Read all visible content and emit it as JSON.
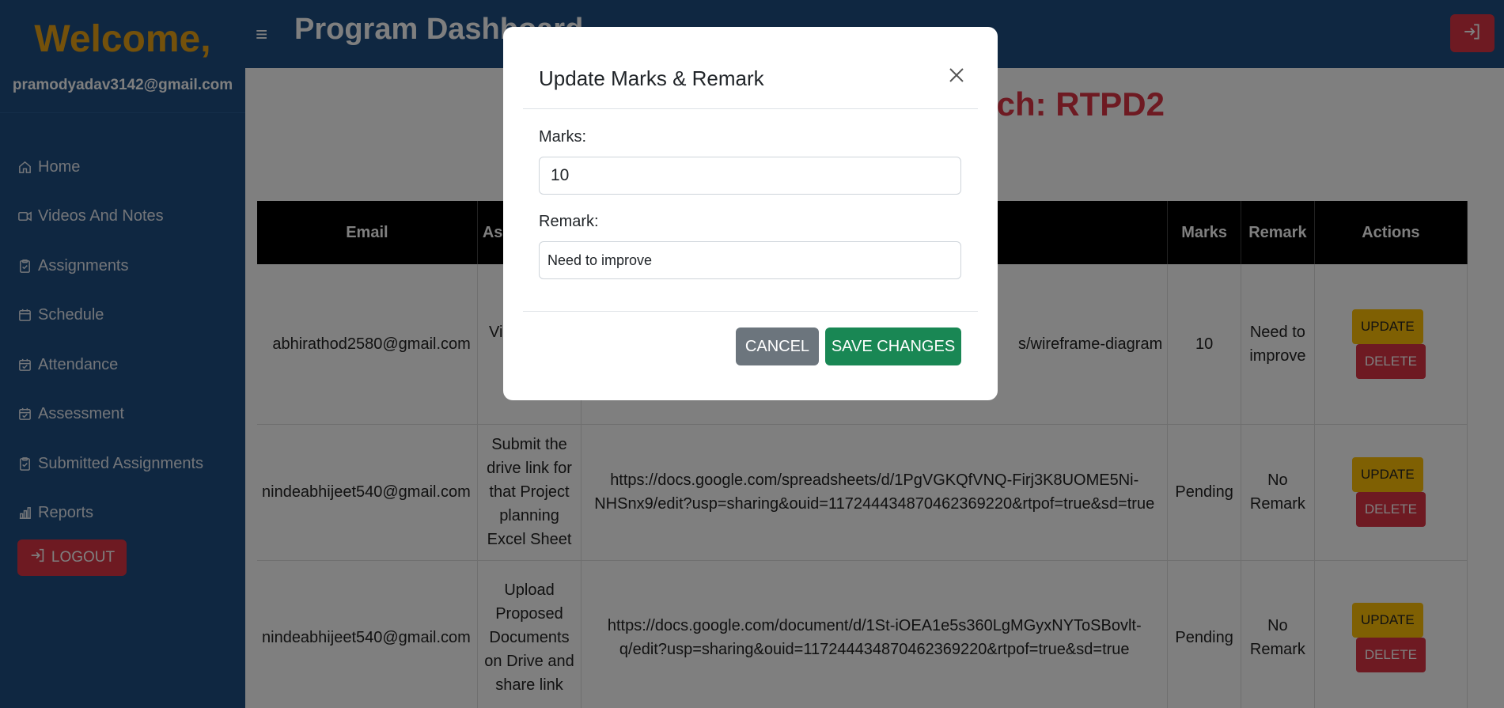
{
  "sidebar": {
    "welcome": "Welcome,",
    "email": "pramodyadav3142@gmail.com",
    "items": [
      {
        "label": "Home",
        "icon": "home-icon"
      },
      {
        "label": "Videos And Notes",
        "icon": "video-icon"
      },
      {
        "label": "Assignments",
        "icon": "clipboard-icon"
      },
      {
        "label": "Schedule",
        "icon": "calendar-icon"
      },
      {
        "label": "Attendance",
        "icon": "calendar-check-icon"
      },
      {
        "label": "Assessment",
        "icon": "calendar-check-icon"
      },
      {
        "label": "Submitted Assignments",
        "icon": "clipboard-icon"
      },
      {
        "label": "Reports",
        "icon": "bar-chart-icon"
      }
    ],
    "logout_label": "LOGOUT"
  },
  "header": {
    "title": "Program Dashboard",
    "menu_icon": "≡"
  },
  "main": {
    "batch_title": "tch: RTPD2",
    "table": {
      "headers": [
        "Email",
        "Ass",
        "",
        "Marks",
        "Remark",
        "Actions"
      ],
      "rows": [
        {
          "email": "abhirathod2580@gmail.com",
          "assignment": "Vie T Vi u n here",
          "link": "s/wireframe-diagram",
          "marks": "10",
          "remark": "Need to improve"
        },
        {
          "email": "nindeabhijeet540@gmail.com",
          "assignment": "Submit the drive link for that Project planning Excel Sheet",
          "link": "https://docs.google.com/spreadsheets/d/1PgVGKQfVNQ-Firj3K8UOME5Ni-NHSnx9/edit?usp=sharing&ouid=117244434870462369220&rtpof=true&sd=true",
          "marks": "Pending",
          "remark": "No Remark"
        },
        {
          "email": "nindeabhijeet540@gmail.com",
          "assignment": "Upload Proposed Documents on Drive and share link",
          "link": "https://docs.google.com/document/d/1St-iOEA1e5s360LgMGyxNYToSBovlt-q/edit?usp=sharing&ouid=117244434870462369220&rtpof=true&sd=true",
          "marks": "Pending",
          "remark": "No Remark"
        }
      ],
      "update_label": "UPDATE",
      "delete_label": "DELETE"
    }
  },
  "modal": {
    "title": "Update Marks & Remark",
    "marks_label": "Marks:",
    "marks_value": "10",
    "remark_label": "Remark:",
    "remark_value": "Need to improve",
    "cancel_label": "CANCEL",
    "save_label": "SAVE CHANGES"
  },
  "colors": {
    "sidebar_bg": "#1f4f82",
    "welcome": "#e8a317",
    "danger": "#dc3545",
    "warning": "#ffc107",
    "success": "#198754",
    "secondary": "#6c757d"
  }
}
